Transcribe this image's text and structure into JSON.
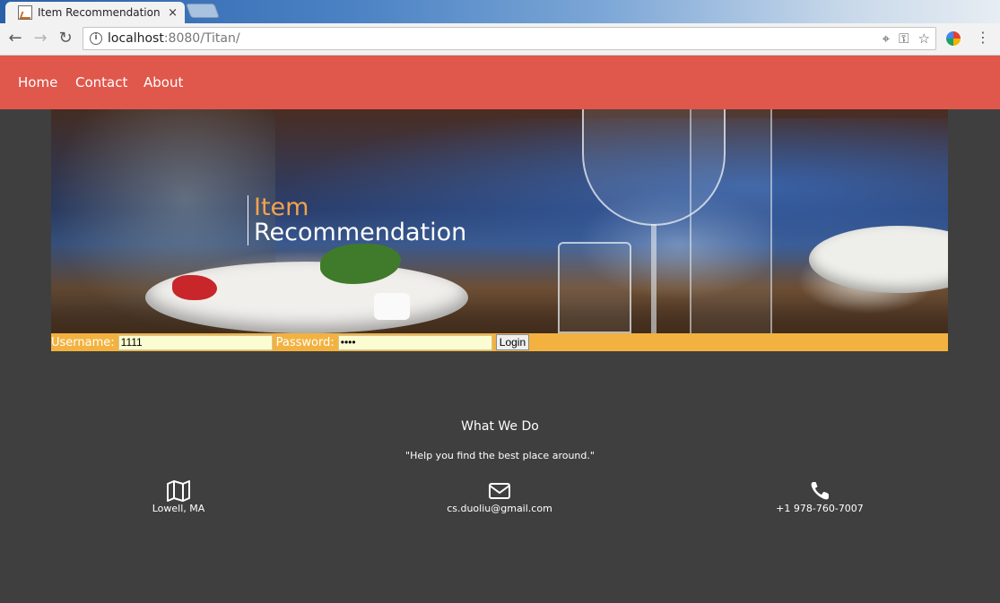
{
  "browser": {
    "tab_title": "Item Recommendation F",
    "tab_close": "×",
    "url_host": "localhost",
    "url_rest": ":8080/Titan/"
  },
  "nav": {
    "items": [
      {
        "label": "Home"
      },
      {
        "label": "Contact"
      },
      {
        "label": "About"
      }
    ]
  },
  "hero": {
    "title_line1": "Item",
    "title_line2": "Recommendation"
  },
  "login": {
    "username_label": "Username:",
    "username_value": "1111",
    "password_label": "Password:",
    "password_value": "1111",
    "login_button": "Login"
  },
  "about": {
    "title": "What We Do",
    "quote": "\"Help you find the best place around.\""
  },
  "contact": {
    "location": "Lowell, MA",
    "email": "cs.duoliu@gmail.com",
    "phone": "+1 978-760-7007"
  },
  "colors": {
    "nav_bg": "#e0574b",
    "page_bg": "#3f3f3f",
    "login_bar": "#f3b23f",
    "hero_accent": "#f3a24b"
  }
}
